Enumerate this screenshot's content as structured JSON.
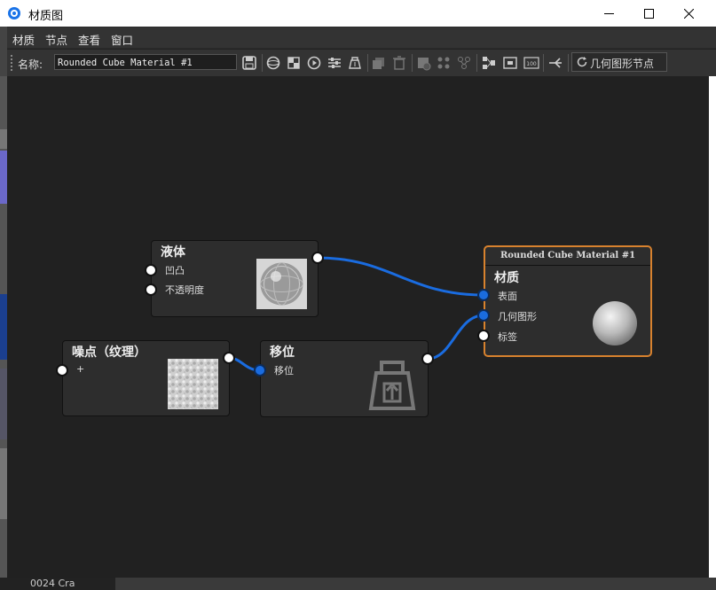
{
  "window": {
    "title": "材质图"
  },
  "menu": {
    "items": [
      "材质",
      "节点",
      "查看",
      "窗口"
    ]
  },
  "toolbar": {
    "name_label": "名称:",
    "name_value": "Rounded Cube Material #1",
    "geometry_button": "几何图形节点"
  },
  "nodes": {
    "liquid": {
      "title": "液体",
      "ports": [
        "凹凸",
        "不透明度"
      ]
    },
    "noise": {
      "title": "噪点（纹理）",
      "port_label": "+"
    },
    "displace": {
      "title": "移位",
      "port_label": "移位"
    },
    "material": {
      "header": "Rounded Cube Material #1",
      "title": "材质",
      "ports": [
        "表面",
        "几何图形",
        "标签"
      ]
    }
  },
  "bottom": {
    "text": "0024 Cra"
  },
  "colors": {
    "wire": "#1a6ce0",
    "selected_border": "#d8822e",
    "port_white": "#ffffff",
    "port_blue": "#1a6ce0"
  }
}
